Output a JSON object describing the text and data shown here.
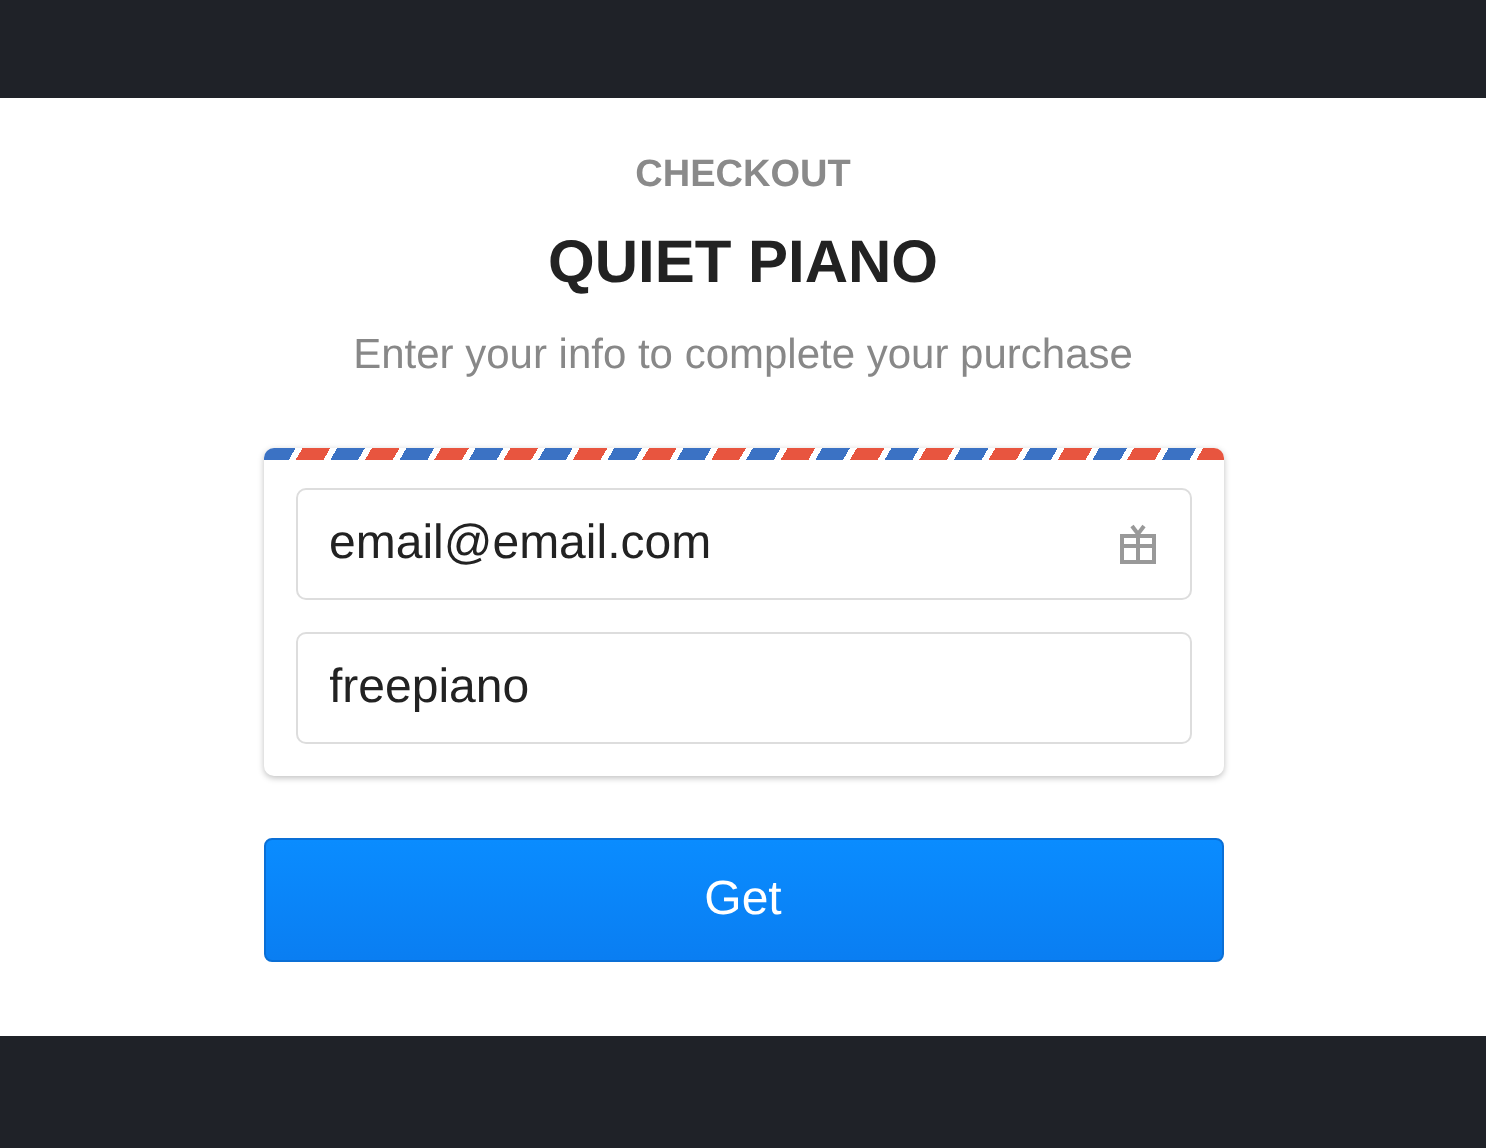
{
  "header": {
    "eyebrow": "CHECKOUT",
    "title": "QUIET PIANO",
    "subtitle": "Enter your info to complete your purchase"
  },
  "fields": [
    {
      "value": "email@email.com",
      "kind": "gift"
    },
    {
      "value": "freepiano",
      "kind": "plain"
    }
  ],
  "button": {
    "label": "Get"
  }
}
